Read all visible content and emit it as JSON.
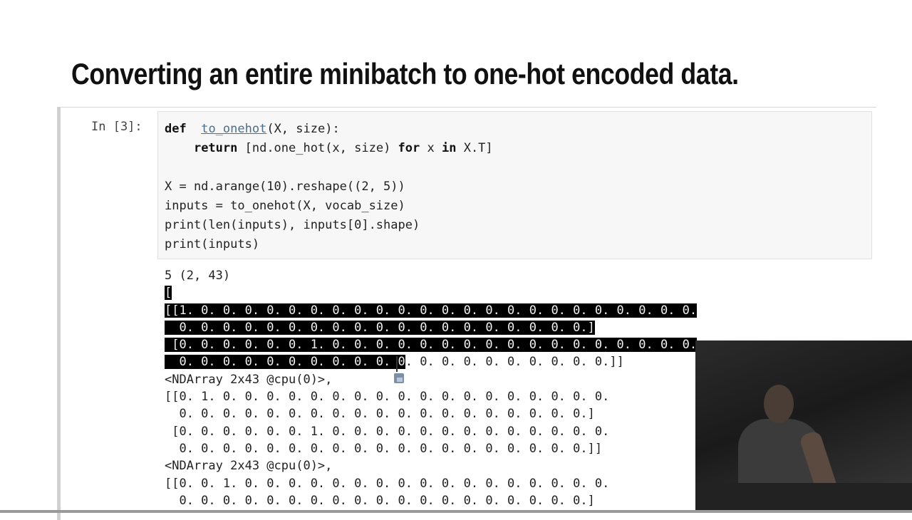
{
  "slide": {
    "title": "Converting an entire minibatch to one-hot encoded data."
  },
  "cell": {
    "prompt": "In [3]:",
    "code_lines": [
      [
        [
          "kw",
          "def"
        ],
        [
          "",
          "  "
        ],
        [
          "fn",
          "to_onehot"
        ],
        [
          "",
          "(X, size):"
        ]
      ],
      [
        [
          "",
          "    "
        ],
        [
          "kw",
          "return"
        ],
        [
          "",
          " [nd.one_hot(x, size) "
        ],
        [
          "kw",
          "for"
        ],
        [
          "",
          " x "
        ],
        [
          "kw",
          "in"
        ],
        [
          "",
          " X.T]"
        ]
      ],
      [
        [
          "",
          ""
        ]
      ],
      [
        [
          "",
          "X = nd.arange(10).reshape((2, 5))"
        ]
      ],
      [
        [
          "",
          "inputs = to_onehot(X, vocab_size)"
        ]
      ],
      [
        [
          "",
          "print(len(inputs), inputs[0].shape)"
        ]
      ],
      [
        [
          "",
          "print(inputs)"
        ]
      ]
    ]
  },
  "output": {
    "lines": [
      [
        [
          "",
          "5 (2, 43)"
        ]
      ],
      [
        [
          "sel",
          "["
        ]
      ],
      [
        [
          "sel",
          "[[1. 0. 0. 0. 0. 0. 0. 0. 0. 0. 0. 0. 0. 0. 0. 0. 0. 0. 0. 0. 0. 0. 0. 0."
        ]
      ],
      [
        [
          "sel",
          "  0. 0. 0. 0. 0. 0. 0. 0. 0. 0. 0. 0. 0. 0. 0. 0. 0. 0. 0.]"
        ]
      ],
      [
        [
          "sel",
          " [0. 0. 0. 0. 0. 0. 1. 0. 0. 0. 0. 0. 0. 0. 0. 0. 0. 0. 0. 0. 0. 0. 0. 0."
        ]
      ],
      [
        [
          "sel",
          "  0. 0. 0. 0. 0. 0. 0. 0. 0. 0. 0"
        ],
        [
          "",
          ". 0. 0. 0. 0. 0. 0. 0. 0. 0.]]"
        ]
      ],
      [
        [
          "",
          "<NDArray 2x43 @cpu(0)>,"
        ]
      ],
      [
        [
          "",
          "[[0. 1. 0. 0. 0. 0. 0. 0. 0. 0. 0. 0. 0. 0. 0. 0. 0. 0. 0. 0."
        ]
      ],
      [
        [
          "",
          "  0. 0. 0. 0. 0. 0. 0. 0. 0. 0. 0. 0. 0. 0. 0. 0. 0. 0. 0.]"
        ]
      ],
      [
        [
          "",
          " [0. 0. 0. 0. 0. 0. 1. 0. 0. 0. 0. 0. 0. 0. 0. 0. 0. 0. 0. 0."
        ]
      ],
      [
        [
          "",
          "  0. 0. 0. 0. 0. 0. 0. 0. 0. 0. 0. 0. 0. 0. 0. 0. 0. 0. 0.]]"
        ]
      ],
      [
        [
          "",
          "<NDArray 2x43 @cpu(0)>,"
        ]
      ],
      [
        [
          "",
          "[[0. 0. 1. 0. 0. 0. 0. 0. 0. 0. 0. 0. 0. 0. 0. 0. 0. 0. 0. 0."
        ]
      ],
      [
        [
          "",
          "  0. 0. 0. 0. 0. 0. 0. 0. 0. 0. 0. 0. 0. 0. 0. 0. 0. 0. 0.]"
        ]
      ]
    ]
  },
  "icons": {
    "cursor": "mouse-cursor-icon",
    "text_cursor": "text-cursor-icon"
  },
  "colors": {
    "selection": "#000000",
    "code_background": "#f7f7f7"
  }
}
